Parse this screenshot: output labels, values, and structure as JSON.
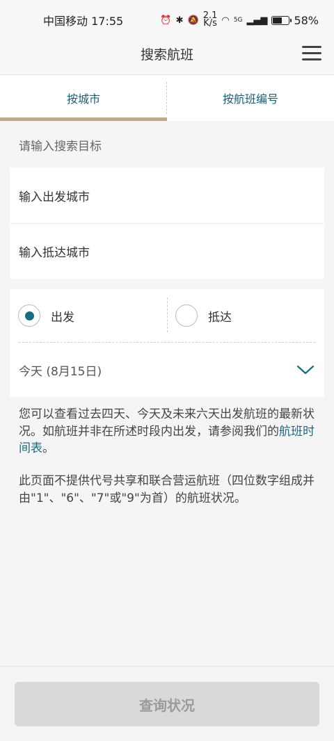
{
  "status_bar": {
    "carrier_time": "中国移动 17:55",
    "net_speed_top": "2.1",
    "net_speed_bottom": "K/s",
    "signal": "5G",
    "battery": "58%",
    "battery_level": 0.58
  },
  "header": {
    "title": "搜索航班"
  },
  "tabs": [
    {
      "label": "按城市",
      "active": true
    },
    {
      "label": "按航班编号",
      "active": false
    }
  ],
  "search": {
    "prompt": "请输入搜索目标",
    "departure_placeholder": "输入出发城市",
    "arrival_placeholder": "输入抵达城市"
  },
  "direction": {
    "options": [
      {
        "label": "出发",
        "selected": true
      },
      {
        "label": "抵达",
        "selected": false
      }
    ],
    "date": "今天 (8月15日)"
  },
  "info": {
    "para1_text": "您可以查看过去四天、今天及未来六天出发航班的最新状况。如航班并非在所述时段内出发，请参阅我们的",
    "para1_link": "航班时间表",
    "para1_end": "。",
    "para2": "此页面不提供代号共享和联合营运航班（四位数字组成并由\"1\"、\"6\"、\"7\"或\"9\"为首）的航班状况。"
  },
  "footer": {
    "query_button": "查询状况"
  },
  "colors": {
    "accent": "#1a5f73",
    "tab_underline": "#bca98a",
    "radio_on": "#176b82"
  }
}
